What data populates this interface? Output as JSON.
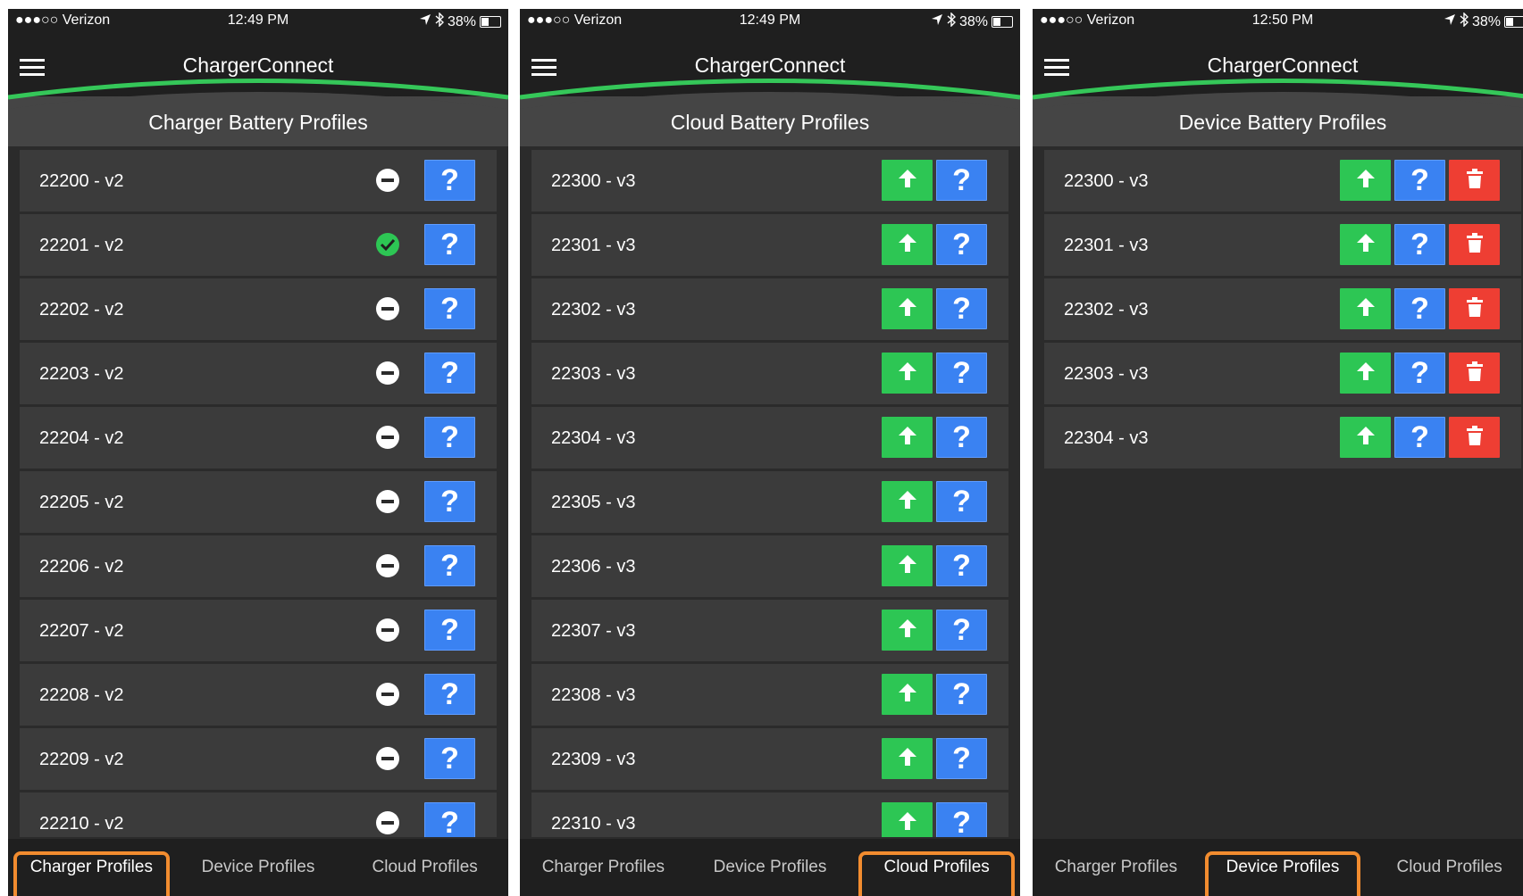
{
  "screens": [
    {
      "status": {
        "carrier": "●●●○○ Verizon",
        "time": "12:49 PM",
        "battery": "38%",
        "battery_level": 0.38
      },
      "app_title": "ChargerConnect",
      "section_title": "Charger Battery Profiles",
      "rows": [
        {
          "label": "22200 - v2",
          "status": "inactive"
        },
        {
          "label": "22201 - v2",
          "status": "active"
        },
        {
          "label": "22202 - v2",
          "status": "inactive"
        },
        {
          "label": "22203 - v2",
          "status": "inactive"
        },
        {
          "label": "22204 - v2",
          "status": "inactive"
        },
        {
          "label": "22205 - v2",
          "status": "inactive"
        },
        {
          "label": "22206 - v2",
          "status": "inactive"
        },
        {
          "label": "22207 - v2",
          "status": "inactive"
        },
        {
          "label": "22208 - v2",
          "status": "inactive"
        },
        {
          "label": "22209 - v2",
          "status": "inactive"
        },
        {
          "label": "22210 - v2",
          "status": "inactive"
        }
      ],
      "actions": [
        "help"
      ],
      "tabs": [
        "Charger Profiles",
        "Device Profiles",
        "Cloud Profiles"
      ],
      "active_tab": 0
    },
    {
      "status": {
        "carrier": "●●●○○ Verizon",
        "time": "12:49 PM",
        "battery": "38%",
        "battery_level": 0.38
      },
      "app_title": "ChargerConnect",
      "section_title": "Cloud Battery Profiles",
      "rows": [
        {
          "label": "22300 - v3"
        },
        {
          "label": "22301 - v3"
        },
        {
          "label": "22302 - v3"
        },
        {
          "label": "22303 - v3"
        },
        {
          "label": "22304 - v3"
        },
        {
          "label": "22305 - v3"
        },
        {
          "label": "22306 - v3"
        },
        {
          "label": "22307 - v3"
        },
        {
          "label": "22308 - v3"
        },
        {
          "label": "22309 - v3"
        },
        {
          "label": "22310 - v3"
        }
      ],
      "actions": [
        "upload",
        "help"
      ],
      "tabs": [
        "Charger Profiles",
        "Device Profiles",
        "Cloud Profiles"
      ],
      "active_tab": 2
    },
    {
      "status": {
        "carrier": "●●●○○ Verizon",
        "time": "12:50 PM",
        "battery": "38%",
        "battery_level": 0.38
      },
      "app_title": "ChargerConnect",
      "section_title": "Device Battery Profiles",
      "rows": [
        {
          "label": "22300 - v3"
        },
        {
          "label": "22301 - v3"
        },
        {
          "label": "22302 - v3"
        },
        {
          "label": "22303 - v3"
        },
        {
          "label": "22304 - v3"
        }
      ],
      "actions": [
        "upload",
        "help",
        "delete"
      ],
      "tabs": [
        "Charger Profiles",
        "Device Profiles",
        "Cloud Profiles"
      ],
      "active_tab": 1
    }
  ],
  "help_glyph": "?",
  "colors": {
    "accent_green": "#35c759",
    "help_blue": "#3a82f2",
    "upload_green": "#2dc654",
    "delete_red": "#ee3e33",
    "tab_highlight": "#f28c2f"
  }
}
